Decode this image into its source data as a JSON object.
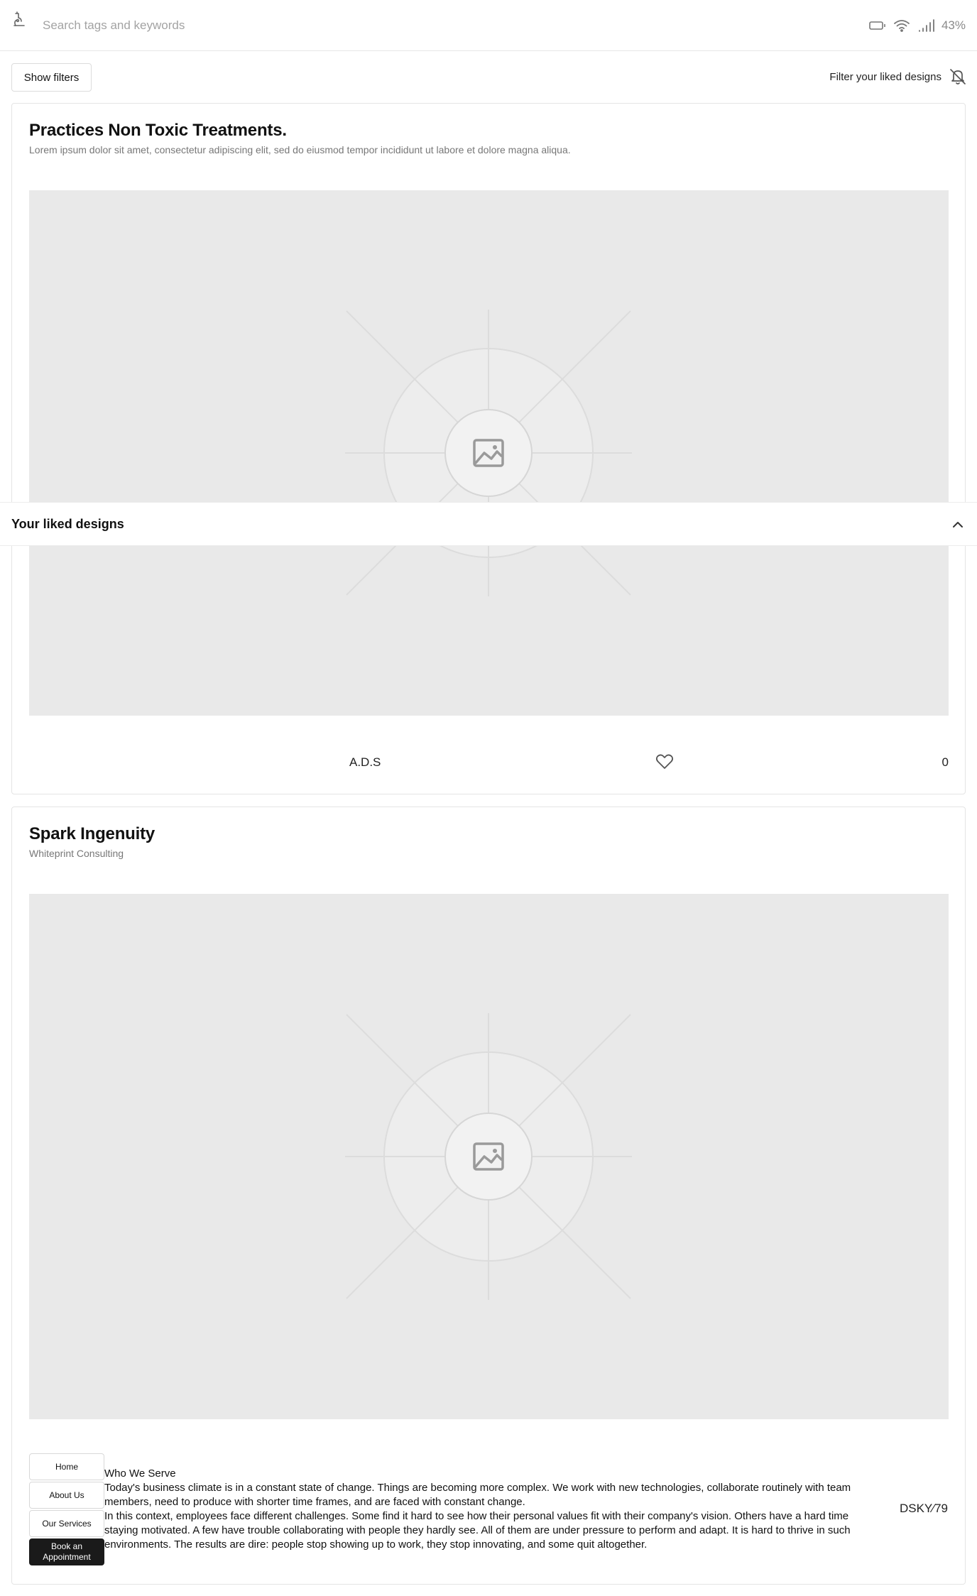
{
  "search": {
    "placeholder": "Search tags and keywords"
  },
  "status_bar": {
    "battery": "43%"
  },
  "filters": {
    "show_filters_label": "Show filters",
    "liked_filter_label": "Filter your liked designs"
  },
  "cards": [
    {
      "title": "Practices Non Toxic Treatments.",
      "subtitle": "Lorem ipsum dolor sit amet, consectetur adipiscing elit, sed do eiusmod tempor incididunt ut labore et dolore magna aliqua.",
      "author": "A.D.S",
      "likes": "0"
    },
    {
      "title": "Spark Ingenuity",
      "subtitle": "Whiteprint Consulting",
      "nav": [
        "Home",
        "About Us",
        "Our Services",
        "Book an Appointment"
      ],
      "heading": "Who We Serve",
      "paragraph_1": "Today's business climate is in a constant state of change. Things are becoming more complex. We work with new technologies, collaborate routinely with team members, need to produce with shorter time frames, and are faced with constant change.",
      "paragraph_2": "In this context, employees face different challenges. Some find it hard to see how their personal values fit with their company's vision. Others have a hard time staying motivated. A few have trouble collaborating with people they hardly see. All of them are under pressure to perform and adapt. It is hard to thrive in such environments. The results are dire: people stop showing up to work, they stop innovating, and some quit altogether.",
      "author": "DSKY∕79"
    }
  ],
  "liked_panel": {
    "title": "Your liked designs"
  }
}
